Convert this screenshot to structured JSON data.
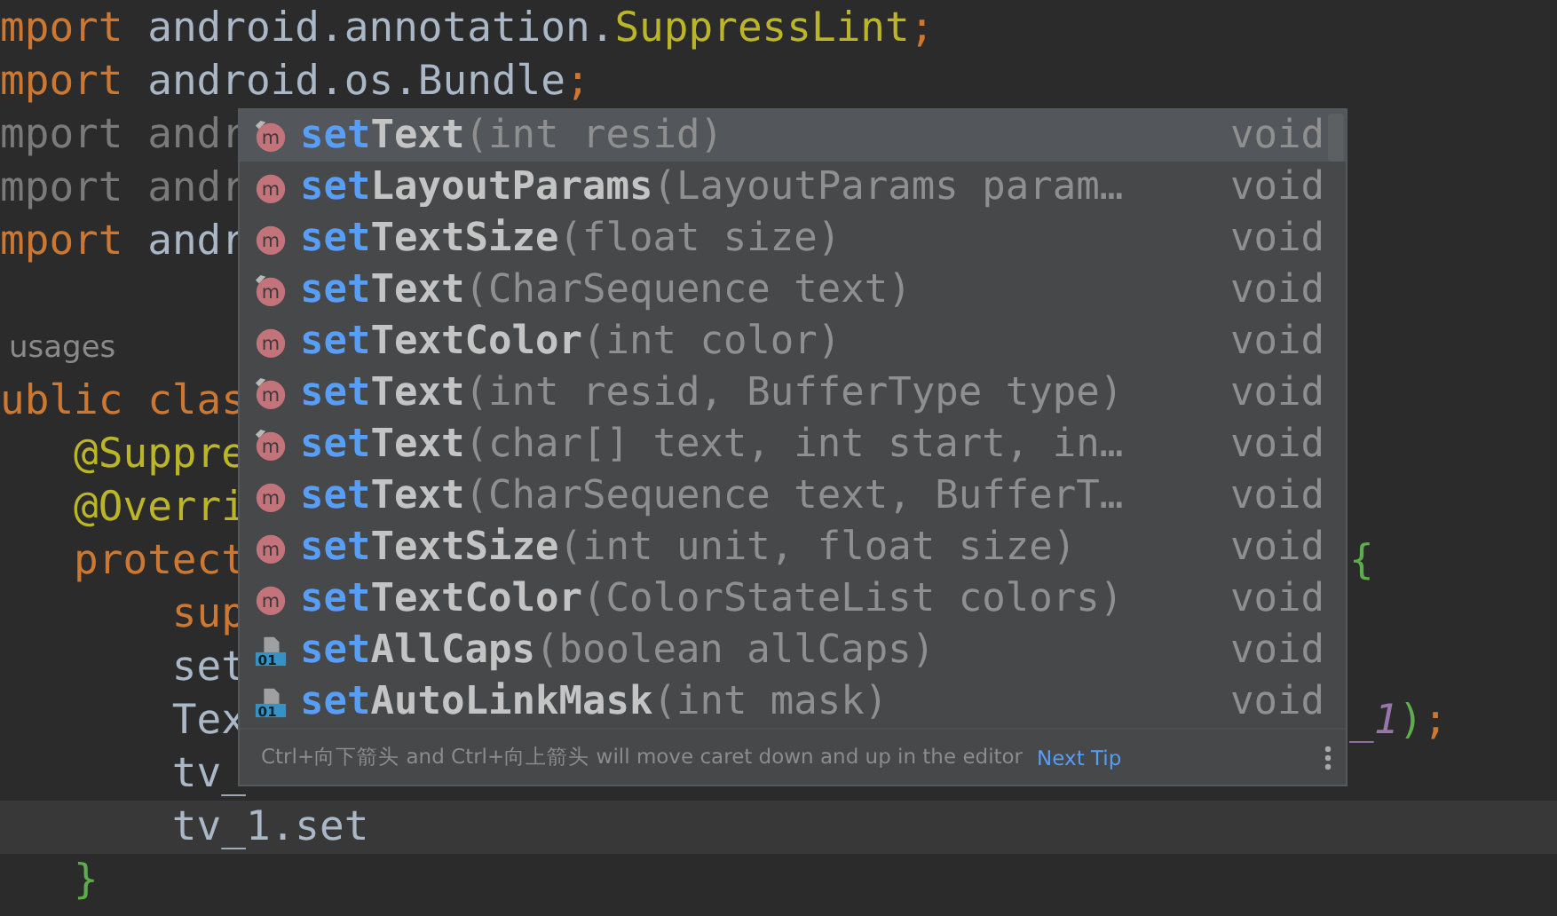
{
  "editor": {
    "lines": [
      {
        "current": false,
        "left": [
          {
            "text": "mport ",
            "kind": "keyword"
          },
          {
            "text": "android.annotation.",
            "kind": "plain"
          },
          {
            "text": "SuppressLint",
            "kind": "annotation"
          },
          {
            "text": ";",
            "kind": "keyword"
          }
        ]
      },
      {
        "current": false,
        "left": [
          {
            "text": "mport ",
            "kind": "keyword"
          },
          {
            "text": "android.os.Bundle",
            "kind": "plain"
          },
          {
            "text": ";",
            "kind": "keyword"
          }
        ]
      },
      {
        "current": false,
        "left": [
          {
            "text": "mport andr",
            "kind": "unused"
          }
        ]
      },
      {
        "current": false,
        "left": [
          {
            "text": "mport andr",
            "kind": "unused"
          }
        ]
      },
      {
        "current": false,
        "left": [
          {
            "text": "mport ",
            "kind": "keyword"
          },
          {
            "text": "andr",
            "kind": "plain"
          }
        ]
      },
      {
        "current": false
      },
      {
        "current": false,
        "left": [
          {
            "text": "usages",
            "kind": "hint"
          }
        ]
      },
      {
        "current": false,
        "left": [
          {
            "text": "ublic clas",
            "kind": "keyword"
          }
        ]
      },
      {
        "current": false,
        "left": [
          {
            "text": "   @Suppre",
            "kind": "annotation"
          }
        ]
      },
      {
        "current": false,
        "left": [
          {
            "text": "   @Overri",
            "kind": "annotation"
          }
        ]
      },
      {
        "current": false,
        "left": [
          {
            "text": "   protect",
            "kind": "keyword"
          }
        ],
        "right": [
          {
            "text": "{",
            "kind": "bracket"
          }
        ]
      },
      {
        "current": false,
        "left": [
          {
            "text": "       sup",
            "kind": "keyword"
          }
        ]
      },
      {
        "current": false,
        "left": [
          {
            "text": "       set",
            "kind": "plain"
          }
        ]
      },
      {
        "current": false,
        "left": [
          {
            "text": "       Tex",
            "kind": "plain"
          }
        ],
        "right": [
          {
            "text": "_1",
            "kind": "field"
          },
          {
            "text": ")",
            "kind": "bracket"
          },
          {
            "text": ";",
            "kind": "keyword"
          }
        ]
      },
      {
        "current": false,
        "left": [
          {
            "text": "       tv_",
            "kind": "plain"
          }
        ]
      },
      {
        "current": true,
        "left": [
          {
            "text": "       tv_1.set",
            "kind": "plain"
          }
        ]
      },
      {
        "current": false,
        "left": [
          {
            "text": "   }",
            "kind": "bracket"
          }
        ]
      }
    ]
  },
  "completion_popup": {
    "items": [
      {
        "kind": "method",
        "icon_letter": "m",
        "inherited": true,
        "match": "set",
        "name": "Text",
        "params": "(int resid)",
        "type": "void",
        "selected": true
      },
      {
        "kind": "method",
        "icon_letter": "m",
        "inherited": false,
        "match": "set",
        "name": "LayoutParams",
        "params": "(LayoutParams param…",
        "type": "void",
        "selected": false
      },
      {
        "kind": "method",
        "icon_letter": "m",
        "inherited": false,
        "match": "set",
        "name": "TextSize",
        "params": "(float size)",
        "type": "void",
        "selected": false
      },
      {
        "kind": "method",
        "icon_letter": "m",
        "inherited": true,
        "match": "set",
        "name": "Text",
        "params": "(CharSequence text)",
        "type": "void",
        "selected": false
      },
      {
        "kind": "method",
        "icon_letter": "m",
        "inherited": false,
        "match": "set",
        "name": "TextColor",
        "params": "(int color)",
        "type": "void",
        "selected": false
      },
      {
        "kind": "method",
        "icon_letter": "m",
        "inherited": true,
        "match": "set",
        "name": "Text",
        "params": "(int resid, BufferType type)",
        "type": "void",
        "selected": false
      },
      {
        "kind": "method",
        "icon_letter": "m",
        "inherited": true,
        "match": "set",
        "name": "Text",
        "params": "(char[] text, int start, in…",
        "type": "void",
        "selected": false
      },
      {
        "kind": "method",
        "icon_letter": "m",
        "inherited": false,
        "match": "set",
        "name": "Text",
        "params": "(CharSequence text, BufferT…",
        "type": "void",
        "selected": false
      },
      {
        "kind": "method",
        "icon_letter": "m",
        "inherited": false,
        "match": "set",
        "name": "TextSize",
        "params": "(int unit, float size)",
        "type": "void",
        "selected": false
      },
      {
        "kind": "method",
        "icon_letter": "m",
        "inherited": false,
        "match": "set",
        "name": "TextColor",
        "params": "(ColorStateList colors)",
        "type": "void",
        "selected": false
      },
      {
        "kind": "property",
        "icon_letter": "01",
        "inherited": false,
        "match": "set",
        "name": "AllCaps",
        "params": "(boolean allCaps)",
        "type": "void",
        "selected": false
      },
      {
        "kind": "property",
        "icon_letter": "01",
        "inherited": false,
        "match": "set",
        "name": "AutoLinkMask",
        "params": "(int mask)",
        "type": "void",
        "selected": false
      }
    ],
    "footer": {
      "tip": "Ctrl+向下箭头 and Ctrl+向上箭头 will move caret down and up in the editor",
      "link": "Next Tip"
    }
  }
}
